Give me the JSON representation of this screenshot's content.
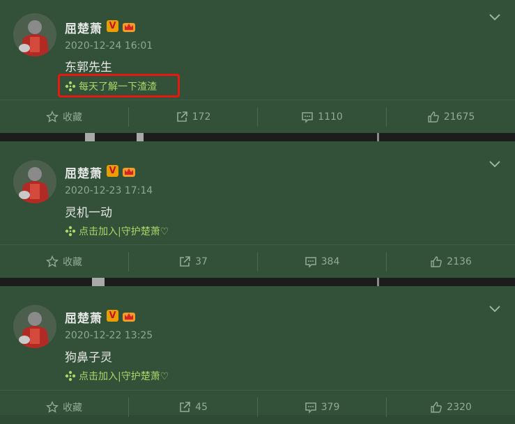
{
  "posts": [
    {
      "author": "屈楚萧",
      "badge_v": "V",
      "time": "2020-12-24 16:01",
      "text": "东郭先生",
      "topic": "每天了解一下渣渣",
      "highlighted": true,
      "actions": {
        "favorite": "收藏",
        "repost": "172",
        "comment": "1110",
        "like": "21675"
      }
    },
    {
      "author": "屈楚萧",
      "badge_v": "V",
      "time": "2020-12-23 17:14",
      "text": "灵机一动",
      "topic": "点击加入|守护楚萧♡",
      "highlighted": false,
      "actions": {
        "favorite": "收藏",
        "repost": "37",
        "comment": "384",
        "like": "2136"
      }
    },
    {
      "author": "屈楚萧",
      "badge_v": "V",
      "time": "2020-12-22 13:25",
      "text": "狗鼻子灵",
      "topic": "点击加入|守护楚萧♡",
      "highlighted": false,
      "actions": {
        "favorite": "收藏",
        "repost": "45",
        "comment": "379",
        "like": "2320"
      }
    }
  ],
  "colors": {
    "card_bg": "#335038",
    "highlight_border": "#e81810",
    "topic_text": "#a8d86a",
    "meta_text": "#93ab95"
  },
  "icons": [
    "avatar",
    "verified-v-icon",
    "crown-icon",
    "chevron-down-icon",
    "topic-leaf-icon",
    "star-icon",
    "share-icon",
    "comment-icon",
    "thumbs-up-icon"
  ]
}
